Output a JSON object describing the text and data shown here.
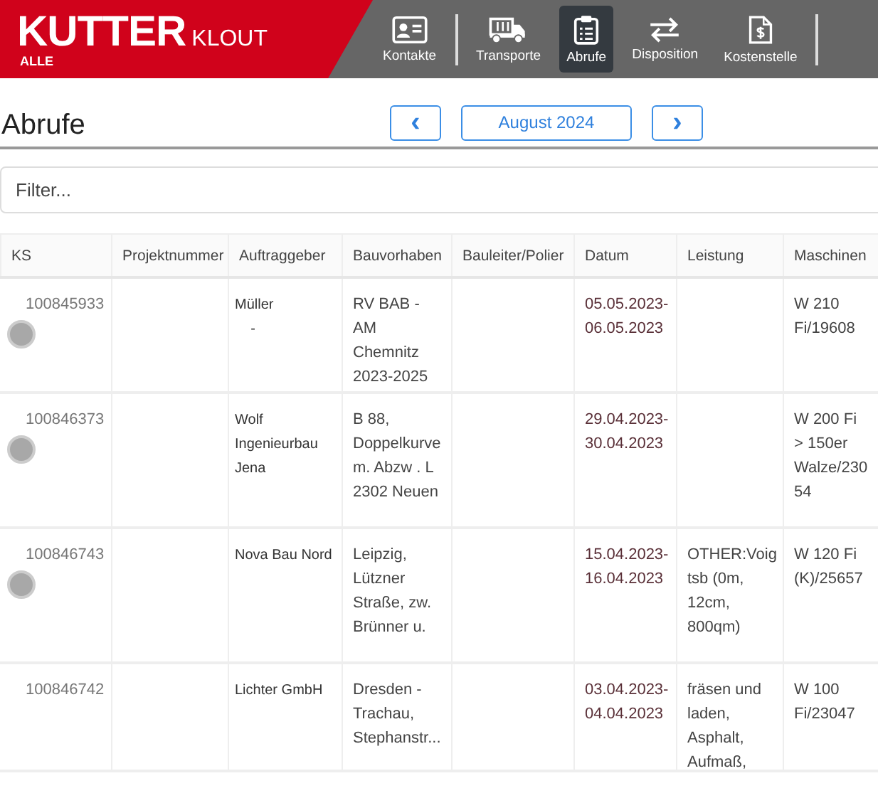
{
  "brand": {
    "name": "KUTTER",
    "suffix": "KLOUT",
    "sub": "ALLE"
  },
  "nav": [
    {
      "label": "Kontakte",
      "kind": "contact",
      "selected": false
    },
    {
      "label": "Transporte",
      "kind": "truck",
      "selected": false
    },
    {
      "label": "Abrufe",
      "kind": "clipboard",
      "selected": true
    },
    {
      "label": "Disposition",
      "kind": "swap",
      "selected": false
    },
    {
      "label": "Kostenstelle",
      "kind": "invoice",
      "selected": false
    }
  ],
  "page_title": "Abrufe",
  "month_nav": {
    "prev": "‹",
    "month": "August 2024",
    "next": "›"
  },
  "filter": {
    "placeholder": "Filter..."
  },
  "table": {
    "columns": [
      "KS",
      "Projektnummer",
      "Auftraggeber",
      "Bauvorhaben",
      "Bauleiter/Polier",
      "Datum",
      "Leistung",
      "Maschinen"
    ],
    "rows": [
      {
        "ks": "100845933",
        "indicator": true,
        "projektnummer": "",
        "auftraggeber": "Müller\n    -",
        "bauvorhaben": "RV BAB -AM Chemnitz 2023-2025",
        "bauleiter": "",
        "datum": "05.05.2023-06.05.2023",
        "leistung": "",
        "maschinen": "W 210 Fi/19608"
      },
      {
        "ks": "100846373",
        "indicator": true,
        "projektnummer": "",
        "auftraggeber": "Wolf Ingenieurbau Jena",
        "bauvorhaben": "B 88, Doppelkurve m. Abzw . L 2302 Neuen",
        "bauleiter": "",
        "datum": "29.04.2023-30.04.2023",
        "leistung": "",
        "maschinen": "W 200 Fi > 150er Walze/23054"
      },
      {
        "ks": "100846743",
        "indicator": true,
        "projektnummer": "",
        "auftraggeber": "Nova Bau Nord",
        "bauvorhaben": "Leipzig, Lützner Straße, zw. Brünner u.",
        "bauleiter": "",
        "datum": "15.04.2023-16.04.2023",
        "leistung": "OTHER:Voigtsb (0m, 12cm, 800qm)",
        "maschinen": "W 120 Fi (K)/25657"
      },
      {
        "ks": "100846742",
        "indicator": false,
        "projektnummer": "",
        "auftraggeber": "Lichter GmbH",
        "bauvorhaben": "Dresden - Trachau, Stephanstr...",
        "bauleiter": "",
        "datum": "03.04.2023-04.04.2023",
        "leistung": "fräsen und laden, Asphalt, Aufmaß,",
        "maschinen": "W 100 Fi/23047"
      }
    ]
  }
}
